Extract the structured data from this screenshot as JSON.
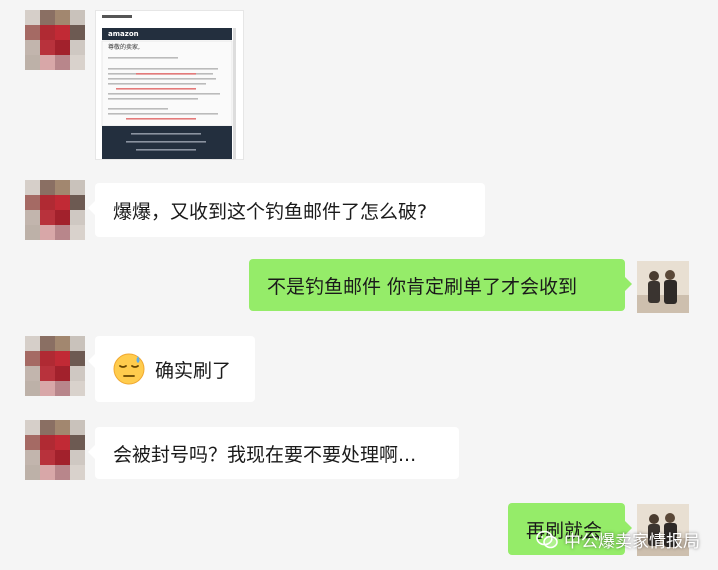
{
  "conversation": {
    "messages": [
      {
        "side": "left",
        "type": "image",
        "image_text": {
          "brand": "amazon",
          "greeting": "尊敬的卖家,"
        }
      },
      {
        "side": "left",
        "type": "text",
        "text": "爆爆，又收到这个钓鱼邮件了怎么破?"
      },
      {
        "side": "right",
        "type": "text",
        "text": "不是钓鱼邮件 你肯定刷单了才会收到"
      },
      {
        "side": "left",
        "type": "text",
        "emoji": "downcast-sweat-face",
        "text": "确实刷了"
      },
      {
        "side": "left",
        "type": "text",
        "text": "会被封号吗？我现在要不要处理啊..."
      },
      {
        "side": "right",
        "type": "text",
        "text": "再刷就会"
      }
    ]
  },
  "watermark": {
    "icon": "wechat-icon",
    "text": "中公爆卖家情报局"
  },
  "colors": {
    "background": "#f5f5f5",
    "bubble_self": "#95ec69",
    "bubble_other": "#ffffff"
  }
}
